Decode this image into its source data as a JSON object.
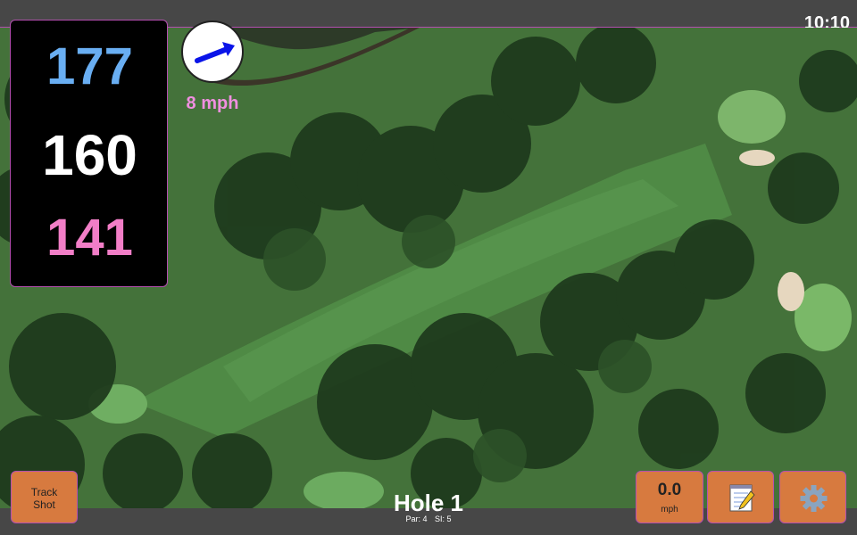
{
  "status_bar": {
    "time": "10:10"
  },
  "distances": {
    "back": "177",
    "middle": "160",
    "front": "141"
  },
  "wind": {
    "speed": "8 mph",
    "direction_icon": "arrow-icon"
  },
  "buttons": {
    "track_shot_line1": "Track",
    "track_shot_line2": "Shot",
    "speed_value": "0.0",
    "speed_unit": "mph",
    "notes_icon": "notepad-icon",
    "settings_icon": "gear-icon"
  },
  "hole": {
    "title": "Hole 1",
    "par": "Par: 4",
    "si": "SI: 5"
  },
  "colors": {
    "accent": "#b44fb0",
    "back_distance": "#69aef2",
    "middle_distance": "#ffffff",
    "front_distance": "#f27ec7",
    "wind_speed": "#f08fe0",
    "button": "#d77a3f",
    "bar": "#474747"
  }
}
